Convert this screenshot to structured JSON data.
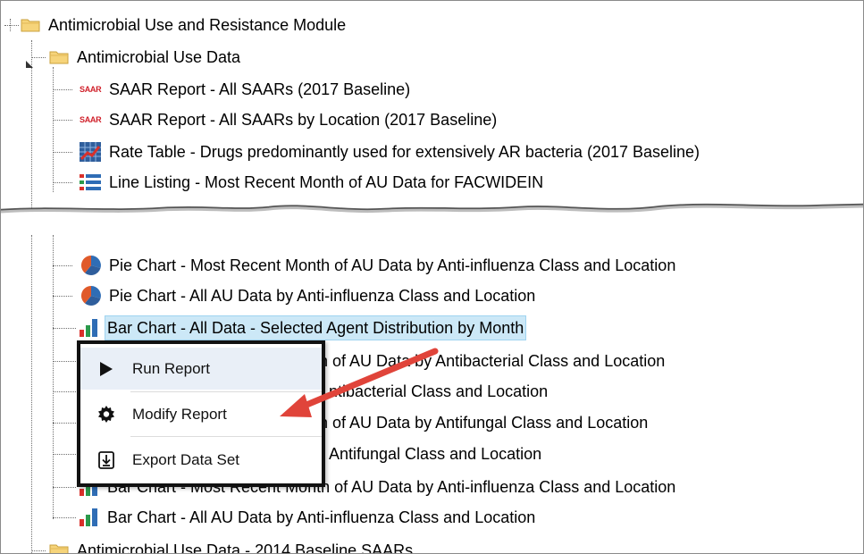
{
  "tree": {
    "root_label": "Antimicrobial Use and Resistance Module",
    "au_folder_label": "Antimicrobial Use Data",
    "items_top": [
      {
        "label": "SAAR Report - All SAARs (2017 Baseline)",
        "icon": "saar-icon",
        "icon_text": "SAAR"
      },
      {
        "label": "SAAR Report - All SAARs by Location (2017 Baseline)",
        "icon": "saar-icon",
        "icon_text": "SAAR"
      },
      {
        "label": "Rate Table - Drugs predominantly used for extensively AR bacteria (2017 Baseline)",
        "icon": "rate-table-icon"
      },
      {
        "label": "Line Listing - Most Recent Month of AU Data for FACWIDEIN",
        "icon": "line-listing-icon"
      }
    ],
    "items_bottom": [
      {
        "label": "Pie Chart - Most Recent Month of AU Data by Anti-influenza Class and Location",
        "icon": "pie-chart-icon"
      },
      {
        "label": "Pie Chart - All AU Data by Anti-influenza Class and Location",
        "icon": "pie-chart-icon"
      },
      {
        "label": "Bar Chart - All Data - Selected Agent Distribution by Month",
        "icon": "bar-chart-icon",
        "selected": true
      },
      {
        "label": "onth of AU Data by Antibacterial Class and Location",
        "icon": "bar-chart-icon"
      },
      {
        "label": "ntibacterial Class and Location",
        "icon": "bar-chart-icon"
      },
      {
        "label": "onth of AU Data by Antifungal Class and Location",
        "icon": "bar-chart-icon"
      },
      {
        "label": "Antifungal Class and Location",
        "icon": "bar-chart-icon"
      },
      {
        "label": "Bar Chart - Most Recent Month of AU Data by Anti-influenza Class and Location",
        "icon": "bar-chart-icon"
      },
      {
        "label": "Bar Chart - All AU Data by Anti-influenza Class and Location",
        "icon": "bar-chart-icon"
      }
    ],
    "next_folder_label": "Antimicrobial Use Data - 2014 Baseline SAARs"
  },
  "context_menu": {
    "run_label": "Run Report",
    "modify_label": "Modify Report",
    "export_label": "Export Data Set"
  },
  "colors": {
    "selection_bg": "#cce8f7",
    "menu_hover": "#e9eff7",
    "arrow": "#e0443a",
    "folder": "#f6d47a"
  }
}
